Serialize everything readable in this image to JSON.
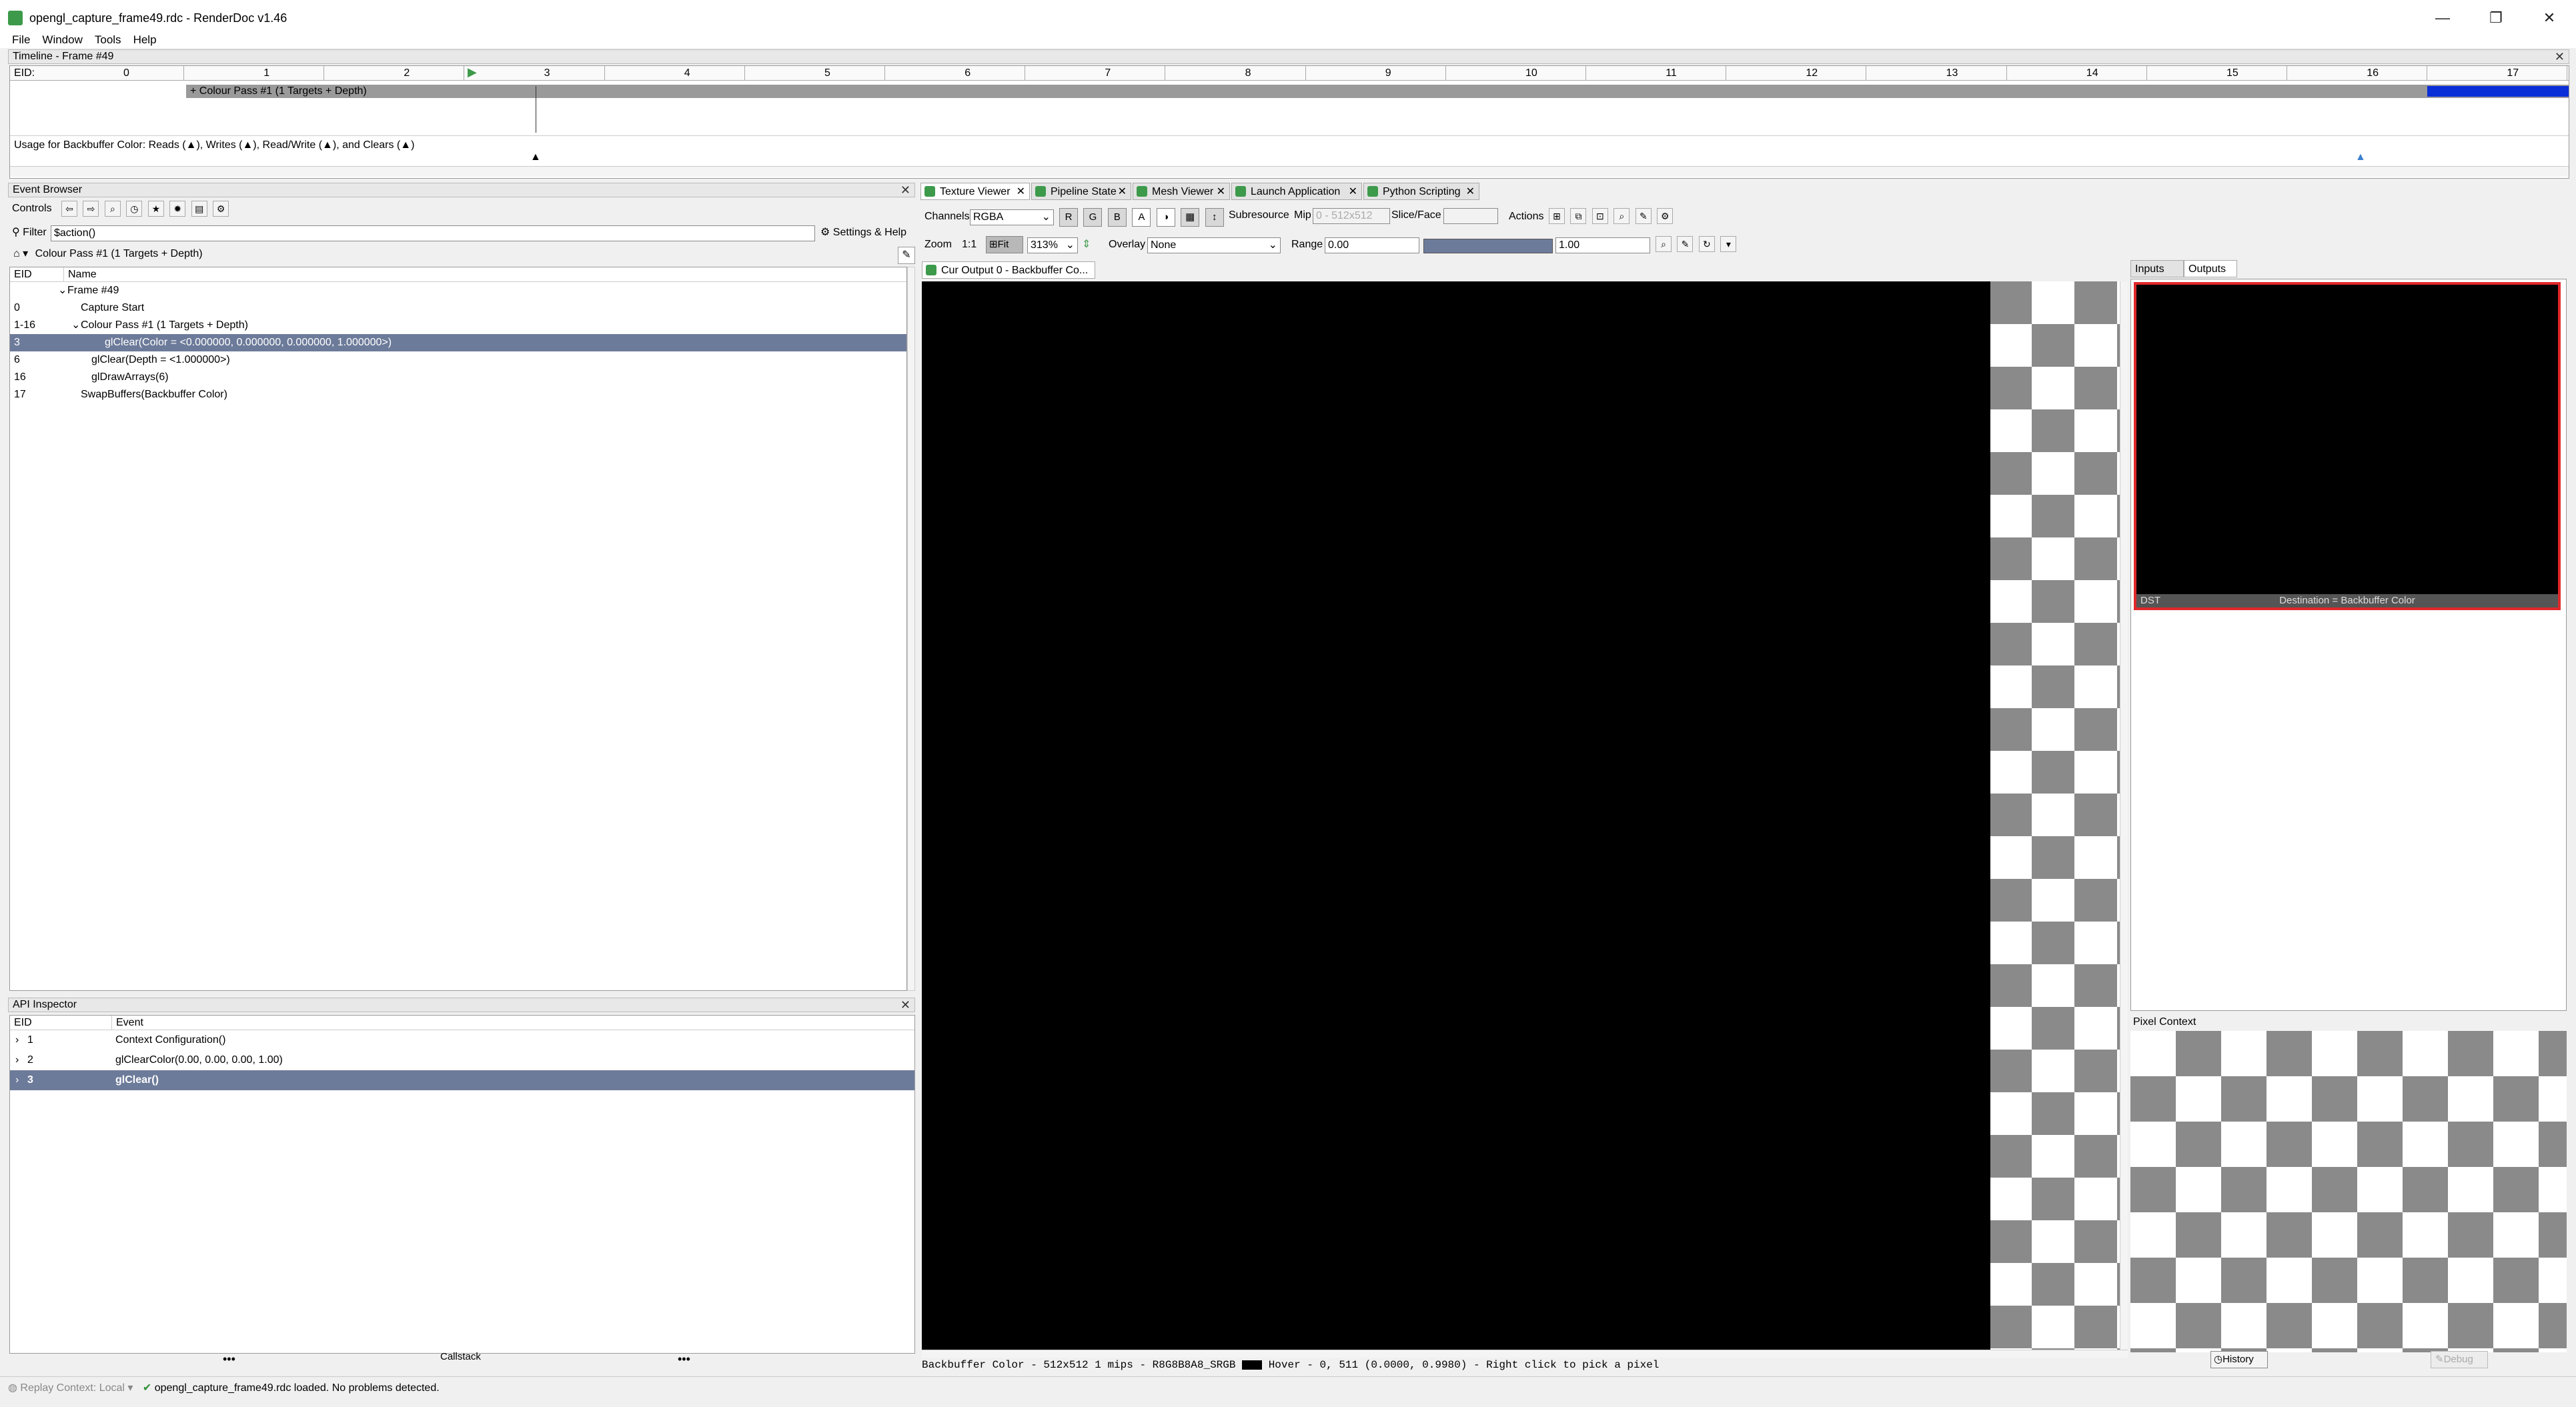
{
  "window": {
    "title": "opengl_capture_frame49.rdc - RenderDoc v1.46",
    "minimize": "—",
    "maximize": "❐",
    "close": "✕"
  },
  "menu": [
    "File",
    "Window",
    "Tools",
    "Help"
  ],
  "timeline": {
    "header": "Timeline - Frame #49",
    "eid_label": "EID:",
    "ticks": [
      "0",
      "1",
      "2",
      "3",
      "4",
      "5",
      "6",
      "7",
      "8",
      "9",
      "10",
      "11",
      "12",
      "13",
      "14",
      "15",
      "16",
      "17"
    ],
    "pass_label": "+ Colour Pass #1 (1 Targets + Depth)",
    "usage_text": "Usage for Backbuffer Color: Reads (▲), Writes (▲), Read/Write (▲), and Clears (▲)"
  },
  "event_browser": {
    "header": "Event Browser",
    "controls_label": "Controls",
    "filter_label": "Filter",
    "filter_value": "$action()",
    "settings_help": "Settings & Help",
    "breadcrumb": "Colour Pass #1 (1 Targets + Depth)",
    "columns": [
      "EID",
      "Name"
    ],
    "rows": [
      {
        "eid": "",
        "name": "Frame #49"
      },
      {
        "eid": "0",
        "name": "Capture Start"
      },
      {
        "eid": "1-16",
        "name": "Colour Pass #1 (1 Targets + Depth)"
      },
      {
        "eid": "3",
        "name": "glClear(Color = <0.000000, 0.000000, 0.000000, 1.000000>)"
      },
      {
        "eid": "6",
        "name": "glClear(Depth = <1.000000>)"
      },
      {
        "eid": "16",
        "name": "glDrawArrays(6)"
      },
      {
        "eid": "17",
        "name": "SwapBuffers(Backbuffer Color)"
      }
    ]
  },
  "api_inspector": {
    "header": "API Inspector",
    "columns": [
      "EID",
      "Event"
    ],
    "rows": [
      {
        "eid": "1",
        "event": "Context Configuration()"
      },
      {
        "eid": "2",
        "event": "glClearColor(0.00, 0.00, 0.00, 1.00)"
      },
      {
        "eid": "3",
        "event": "glClear()"
      }
    ],
    "callstack": "Callstack",
    "dots": "•••"
  },
  "tabs": [
    "Texture Viewer",
    "Pipeline State",
    "Mesh Viewer",
    "Launch Application",
    "Python Scripting"
  ],
  "texture_viewer": {
    "channels_label": "Channels",
    "channels_value": "RGBA",
    "channel_buttons": [
      "R",
      "G",
      "B",
      "A"
    ],
    "subresource_label": "Subresource",
    "mip_label": "Mip",
    "mip_value": "0 - 512x512",
    "slice_label": "Slice/Face",
    "actions_label": "Actions",
    "zoom_label": "Zoom",
    "zoom_1to1": "1:1",
    "fit_label": "Fit",
    "zoom_value": "313%",
    "overlay_label": "Overlay",
    "overlay_value": "None",
    "range_label": "Range",
    "range_min": "0.00",
    "range_max": "1.00",
    "output_tab": "Cur Output 0 - Backbuffer Co...",
    "status_text": "Backbuffer Color - 512x512 1 mips - R8G8B8A8_SRGB",
    "hover_text": "Hover -     0,  511 (0.0000, 0.9980)  - Right click to pick a pixel"
  },
  "thumbs": {
    "tabs": [
      "Inputs",
      "Outputs"
    ],
    "dst_label": "DST",
    "dest_text": "Destination = Backbuffer Color"
  },
  "pixel_context": {
    "header": "Pixel Context",
    "history": "History",
    "debug": "Debug"
  },
  "statusbar": {
    "replay_context": "Replay Context: Local",
    "message": "opengl_capture_frame49.rdc loaded. No problems detected."
  },
  "colors": {
    "selection": "#6d7b9a",
    "accent_green": "#3c9a4a",
    "timeline_blue": "#0a2fd8",
    "thumb_border": "#e0282b"
  }
}
